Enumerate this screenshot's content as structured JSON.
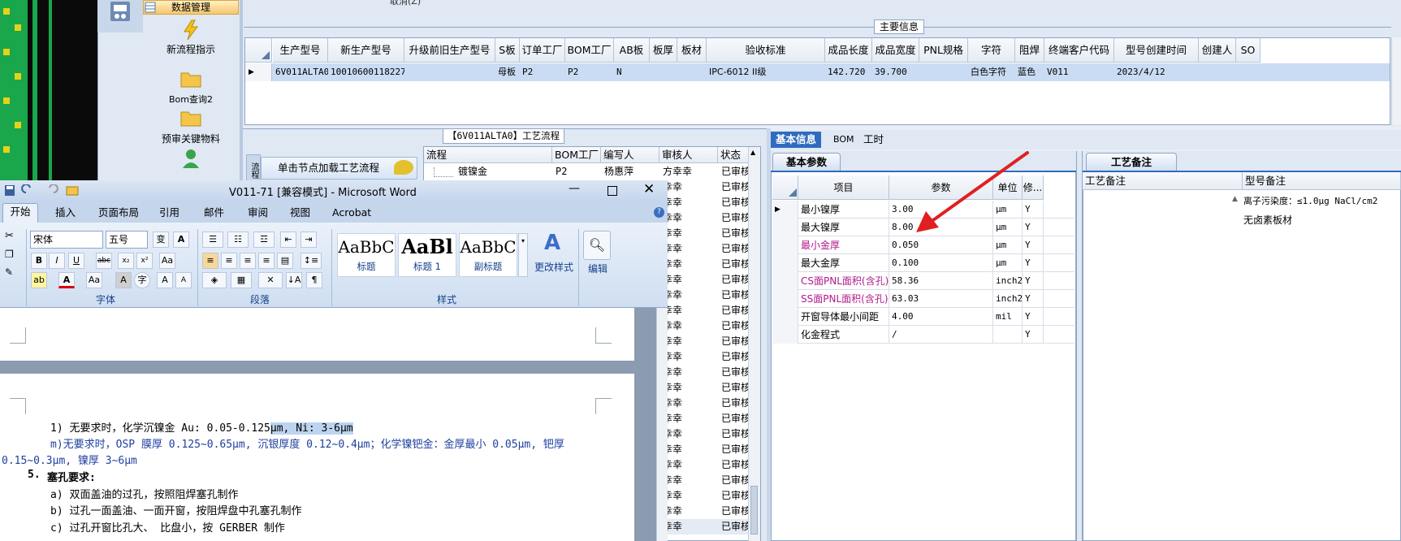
{
  "nav": {
    "header": "数据管理",
    "items": [
      {
        "label": "新流程指示",
        "icon": "lightning-icon"
      },
      {
        "label": "Bom查询2",
        "icon": "folder-icon"
      },
      {
        "label": "预审关键物料",
        "icon": "folder-icon"
      },
      {
        "label": "",
        "icon": "user-icon"
      }
    ]
  },
  "main": {
    "partial_top_text": "取消(Z)",
    "title": "主要信息",
    "columns": [
      "生产型号",
      "新生产型号",
      "升级前旧生产型号",
      "S板",
      "订单工厂",
      "BOM工厂",
      "AB板",
      "板厚",
      "板材",
      "验收标准",
      "成品长度",
      "成品宽度",
      "PNL规格",
      "字符",
      "阻焊",
      "终端客户代码",
      "型号创建时间",
      "创建人",
      "SO"
    ],
    "row": [
      "6V011ALTA0",
      "10010600118227",
      "",
      "母板",
      "P2",
      "P2",
      "N",
      "",
      "",
      "IPC-6012 II级",
      "142.720",
      "39.700",
      "",
      "白色字符",
      "蓝色",
      "V011",
      "2023/4/12",
      "",
      ""
    ]
  },
  "flow": {
    "title": "【6V011ALTA0】工艺流程",
    "button_label": "单击节点加载工艺流程",
    "side_label": "流程",
    "columns": [
      "流程",
      "BOM工厂",
      "编写人",
      "审核人",
      "状态"
    ],
    "first_row": {
      "name": "镀镍金",
      "factory": "P2",
      "author": "杨惠萍",
      "reviewer": "方幸幸",
      "status": "已审核"
    },
    "reviewer_repeat": "幸幸",
    "status_repeat": "已审核"
  },
  "right_tabs": [
    "基本信息",
    "BOM",
    "工时"
  ],
  "basic": {
    "tab_label": "基本参数",
    "columns": [
      "项目",
      "参数",
      "单位",
      "修..."
    ],
    "rows": [
      {
        "item": "最小镍厚",
        "value": "3.00",
        "unit": "μm",
        "mod": "Y",
        "color": "#000000"
      },
      {
        "item": "最大镍厚",
        "value": "8.00",
        "unit": "μm",
        "mod": "Y",
        "color": "#000000"
      },
      {
        "item": "最小金厚",
        "value": "0.050",
        "unit": "μm",
        "mod": "Y",
        "color": "#b01a8c"
      },
      {
        "item": "最大金厚",
        "value": "0.100",
        "unit": "μm",
        "mod": "Y",
        "color": "#000000"
      },
      {
        "item": "CS面PNL面积(含孔)",
        "value": "58.36",
        "unit": "inch2",
        "mod": "Y",
        "color": "#b01a8c"
      },
      {
        "item": "SS面PNL面积(含孔)",
        "value": "63.03",
        "unit": "inch2",
        "mod": "Y",
        "color": "#b01a8c"
      },
      {
        "item": "开窗导体最小间距",
        "value": "4.00",
        "unit": "mil",
        "mod": "Y",
        "color": "#000000"
      },
      {
        "item": "化金程式",
        "value": "/",
        "unit": "",
        "mod": "Y",
        "color": "#000000"
      }
    ]
  },
  "remarks": {
    "tab_label": "工艺备注",
    "columns": [
      "工艺备注",
      "型号备注"
    ],
    "model_remarks": [
      "离子污染度：≤1.0μg NaCl/cm2",
      "无卤素板材"
    ]
  },
  "word": {
    "title": "V011-71 [兼容模式] - Microsoft Word",
    "tabs": [
      "开始",
      "插入",
      "页面布局",
      "引用",
      "邮件",
      "审阅",
      "视图",
      "Acrobat"
    ],
    "font_name": "宋体",
    "font_size": "五号",
    "groups": [
      "字体",
      "段落",
      "样式",
      "编辑"
    ],
    "styles": [
      {
        "preview": "AaBbC",
        "label": "标题"
      },
      {
        "preview": "AaBl",
        "label": "标题 1"
      },
      {
        "preview": "AaBbC",
        "label": "副标题"
      }
    ],
    "change_styles": "更改样式",
    "edit_label": "编辑",
    "doc_lines": {
      "l1_a": "1) 无要求时，化学沉镍金 Au: 0.05-0.125",
      "l1_b": "μm, Ni: 3-6μm",
      "l2": "m)无要求时，OSP 膜厚 0.125~0.65μm, 沉银厚度 0.12~0.4μm；化学镍钯金：金厚最小 0.05μm, 钯厚",
      "l3": "0.15~0.3μm, 镍厚 3~6μm",
      "sec_num": "5.",
      "sec_title": "塞孔要求:",
      "a": "a)  双面盖油的过孔，按照阻焊塞孔制作",
      "b": "b)  过孔一面盖油、一面开窗，按阻焊盘中孔塞孔制作",
      "c": "c)  过孔开窗比孔大、 比盘小，按 GERBER 制作"
    }
  },
  "colors": {
    "accent": "#2f6bbf",
    "selected_row": "#c9dcf3",
    "arrow": "#e02020",
    "magenta_text": "#b01a8c"
  }
}
